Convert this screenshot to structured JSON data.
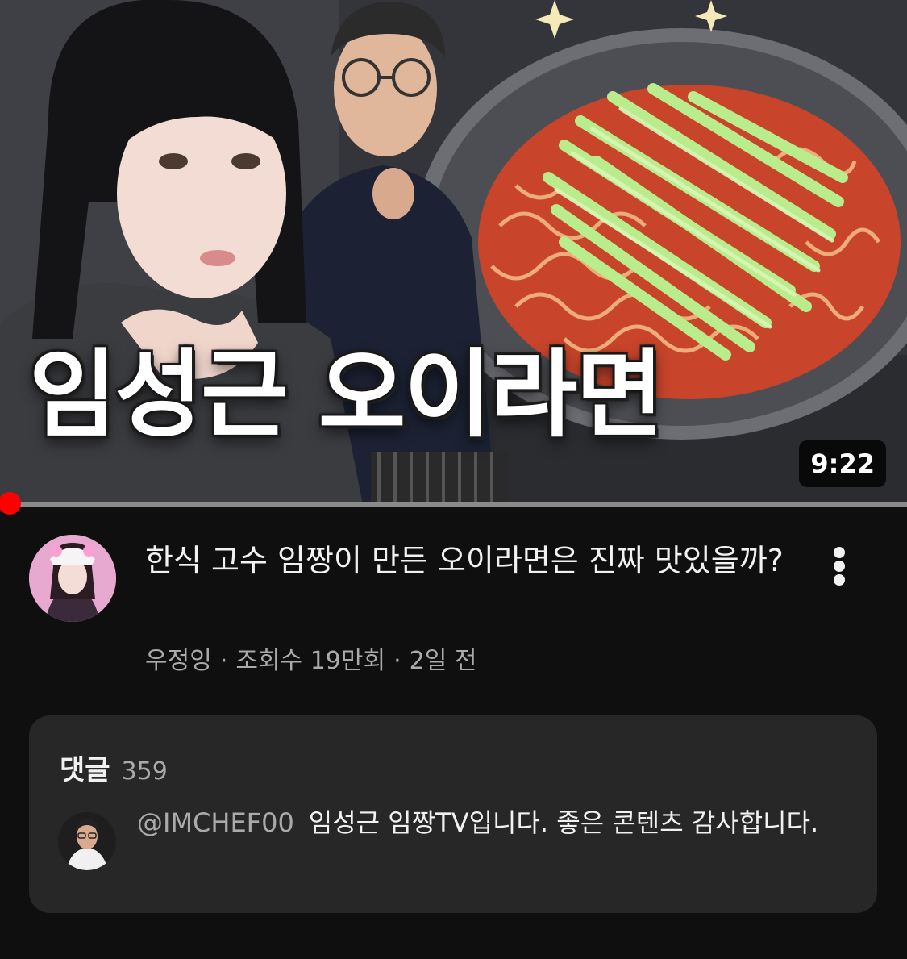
{
  "thumbnail": {
    "overlay_title": "임성근 오이라면",
    "duration": "9:22"
  },
  "player": {
    "progress_fraction": 0.01
  },
  "video": {
    "title": "한식 고수 임짱이 만든 오이라면은 진짜 맛있을까?",
    "channel": "우정잉",
    "views": "조회수 19만회",
    "age": "2일 전",
    "separator": "·"
  },
  "comments": {
    "label": "댓글",
    "count": "359",
    "top_comment": {
      "author": "@IMCHEF00",
      "text": "임성근 임짱TV입니다. 좋은 콘텐츠 감사합니다."
    }
  },
  "icons": {
    "more": "more-vert-icon"
  },
  "colors": {
    "background": "#0f0f0f",
    "card": "#272727",
    "progress_played": "#ff0000",
    "progress_track": "#8a8a8a",
    "secondary_text": "#aaaaaa"
  }
}
